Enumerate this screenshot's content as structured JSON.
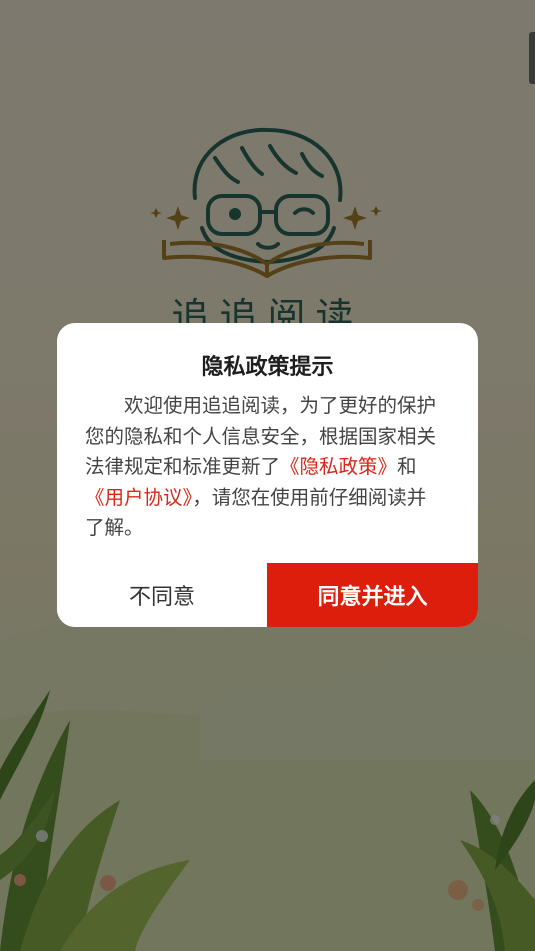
{
  "app": {
    "logo_title": "追追阅读"
  },
  "dialog": {
    "title": "隐私政策提示",
    "body_intro": "欢迎使用追追阅读，为了更好的保护您的隐私和个人信息安全，根据国家相关法律规定和标准更新了",
    "privacy_link": "《隐私政策》",
    "conjunction": "和",
    "agreement_link": "《用户协议》",
    "body_outro": "，请您在使用前仔细阅读并了解。",
    "disagree_label": "不同意",
    "agree_label": "同意并进入"
  },
  "colors": {
    "accent": "#dd1e0c",
    "link": "#d8281a",
    "logo": "#2f6a5c"
  }
}
